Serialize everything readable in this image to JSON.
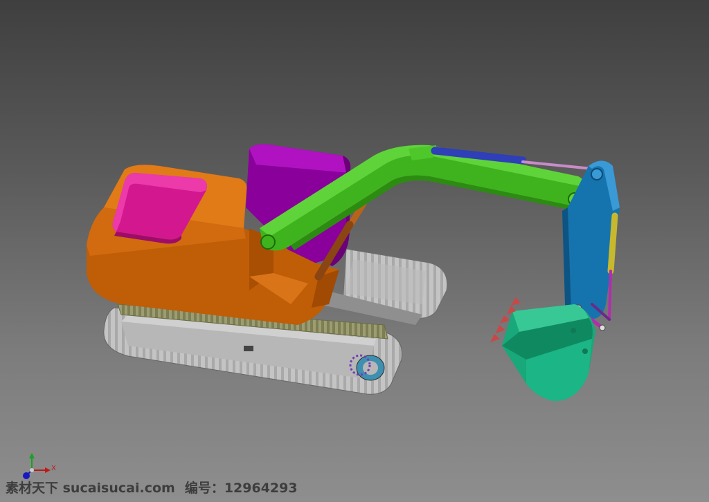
{
  "viewport": {
    "background_top": "#3f3f3f",
    "background_bottom": "#8e8e8e"
  },
  "model": {
    "subject": "excavator-3d-cad-assembly",
    "part_colors": {
      "cab": "#c05d07",
      "cab_top": "#e07b18",
      "roof_panel": "#d3188f",
      "counterweight": "#8a009a",
      "boom": "#3fb31d",
      "arm": "#1574ad",
      "bucket": "#18a87a",
      "boom_cylinder": "#2e3fb8",
      "bucket_cylinder": "#c7b82e",
      "link_rods": "#b42cae",
      "tracks": "#a8a8a8",
      "track_pads": "#8d8d5e",
      "bucket_teeth": "#c84848"
    }
  },
  "triad": {
    "x_label": "X",
    "x_color": "#c01818",
    "y_color": "#1aa024",
    "z_color": "#1818c0"
  },
  "watermark": {
    "site_name": "素材天下 sucaisucai.com",
    "id_text": "编号：12964293"
  }
}
